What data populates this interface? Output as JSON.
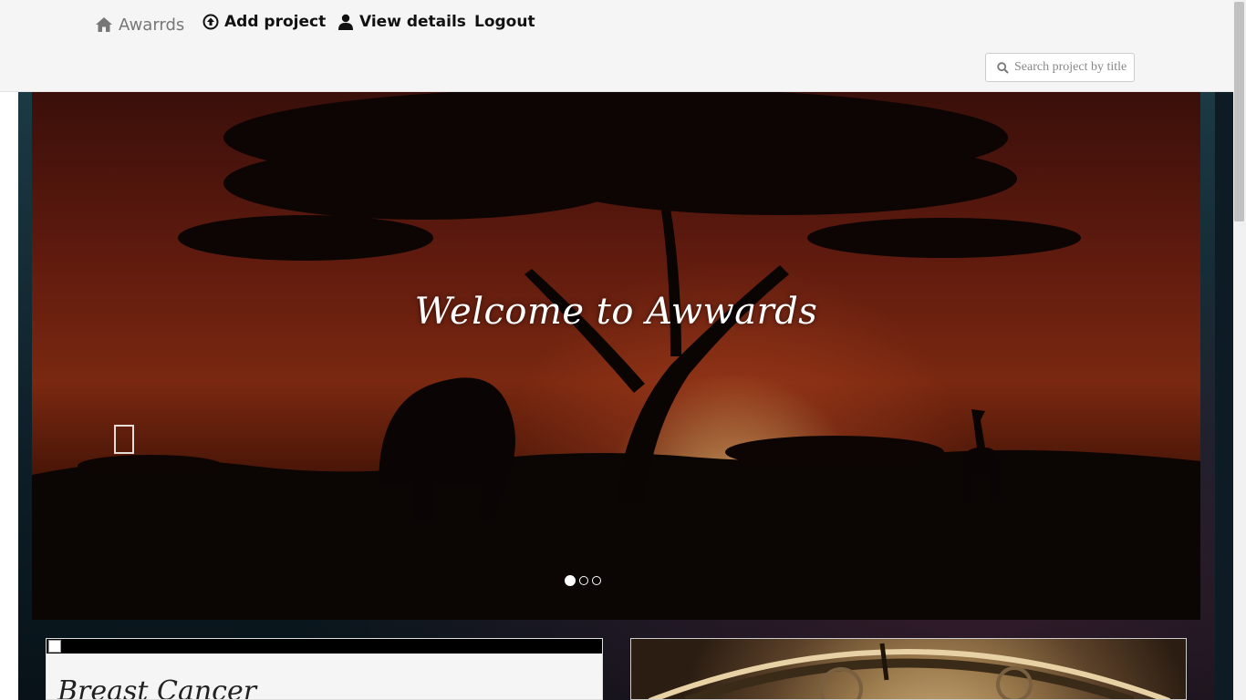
{
  "navbar": {
    "brand": "Awarrds",
    "add_project": "Add project",
    "view_details": "View details",
    "logout": "Logout",
    "search_placeholder": "Search project by title"
  },
  "carousel": {
    "caption": "Welcome to Awwards",
    "indicators": [
      {
        "active": true
      },
      {
        "active": false
      },
      {
        "active": false
      }
    ]
  },
  "projects": [
    {
      "title": "Breast Cancer"
    },
    {
      "title": ""
    }
  ],
  "icons": {
    "brand": "home-icon",
    "add_project": "upload-circle-icon",
    "view_details": "user-icon",
    "search": "search-icon",
    "carousel_prev": "prev-icon"
  },
  "colors": {
    "navbar_bg": "#f5f5f5",
    "brand_text": "#777777",
    "nav_text": "#111111"
  }
}
